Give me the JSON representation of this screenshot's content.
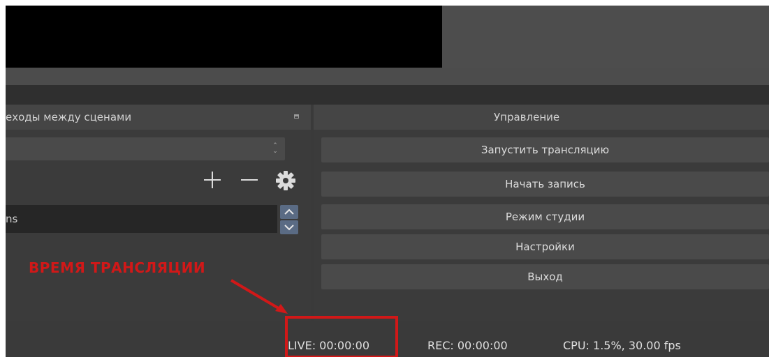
{
  "transitions_dock": {
    "title": "еходы между сценами",
    "duration_value": "ns"
  },
  "controls_dock": {
    "title": "Управление",
    "buttons": [
      "Запустить трансляцию",
      "Начать запись",
      "Режим студии",
      "Настройки",
      "Выход"
    ]
  },
  "annotation": {
    "label": "ВРЕМЯ ТРАНСЛЯЦИИ",
    "color": "#d11818"
  },
  "status_bar": {
    "live": "LIVE: 00:00:00",
    "rec": "REC: 00:00:00",
    "cpu": "CPU: 1.5%, 30.00 fps"
  },
  "icons": [
    "float-icon",
    "spin-icon",
    "plus-icon",
    "minus-icon",
    "gear-icon"
  ]
}
